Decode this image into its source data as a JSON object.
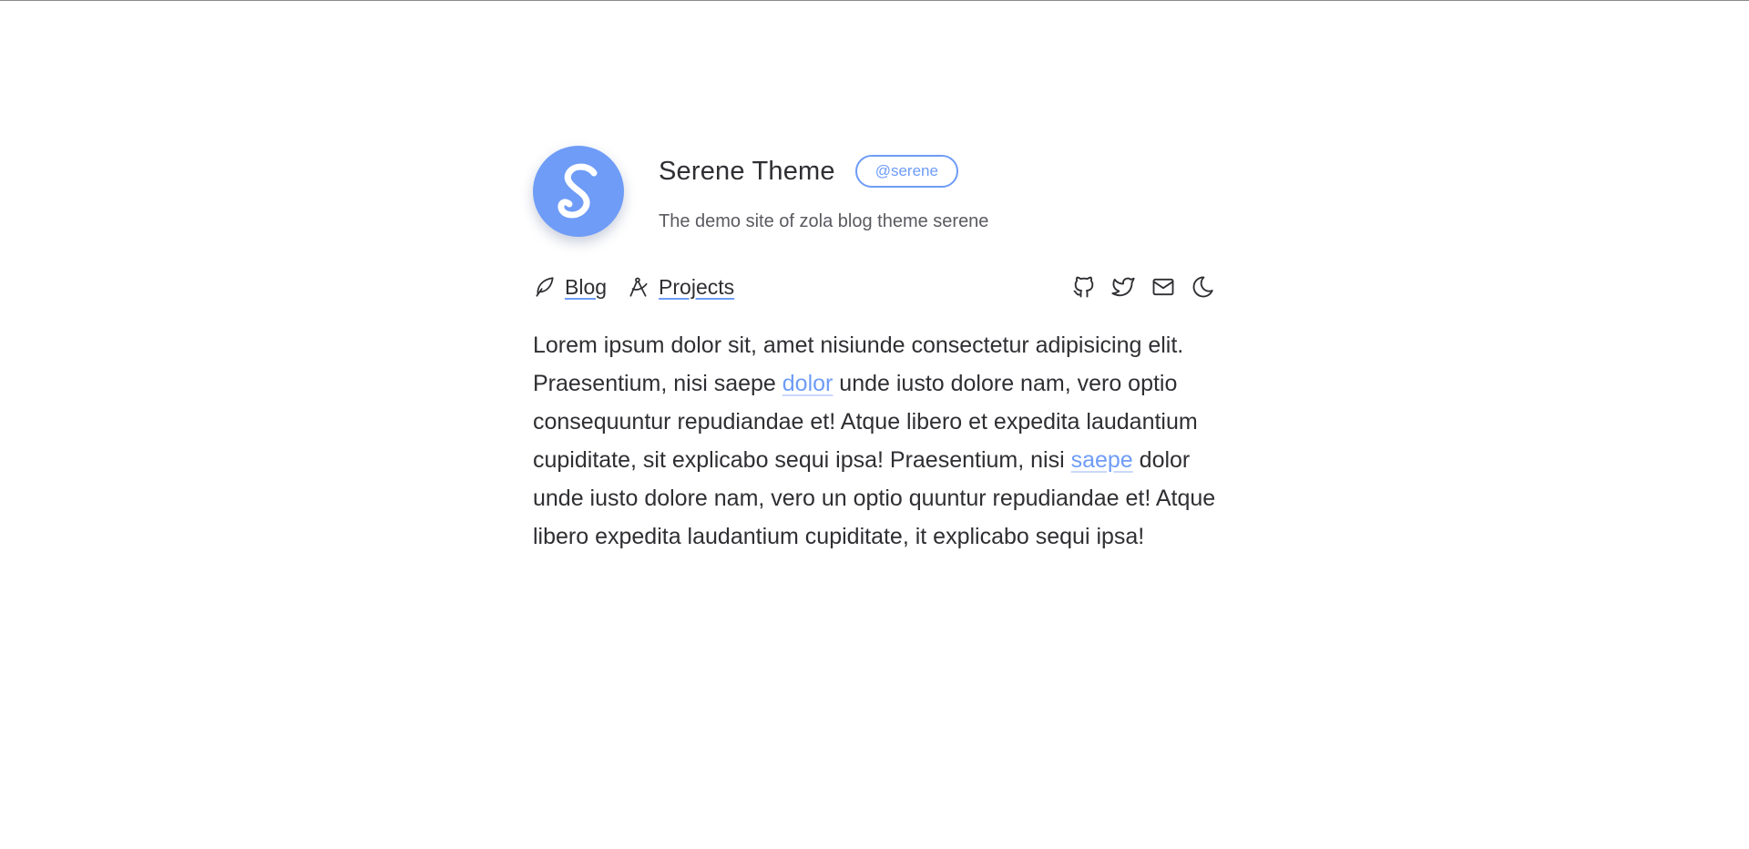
{
  "profile": {
    "avatar_letter": "S",
    "title": "Serene Theme",
    "handle": "@serene",
    "subtitle": "The demo site of zola blog theme serene"
  },
  "nav": {
    "items": [
      {
        "label": "Blog",
        "icon": "feather-icon"
      },
      {
        "label": "Projects",
        "icon": "compass-icon"
      }
    ],
    "social": [
      {
        "icon": "github-icon"
      },
      {
        "icon": "twitter-icon"
      },
      {
        "icon": "mail-icon"
      },
      {
        "icon": "moon-icon"
      }
    ]
  },
  "content": {
    "seg1": "Lorem ipsum dolor sit, amet nisiunde consectetur adipisicing elit. Praesentium, nisi saepe ",
    "link1": "dolor",
    "seg2": " unde iusto dolore nam, vero optio consequuntur repudiandae et! Atque libero et expedita laudantium cupiditate, sit explicabo sequi ipsa! Praesentium, nisi ",
    "link2": "saepe",
    "seg3": " dolor unde iusto dolore nam, vero un optio quuntur repudiandae et! Atque libero expedita laudantium cupiditate, it explicabo sequi ipsa!"
  },
  "colors": {
    "accent": "#6e9cf7",
    "text": "#2f2f33"
  }
}
